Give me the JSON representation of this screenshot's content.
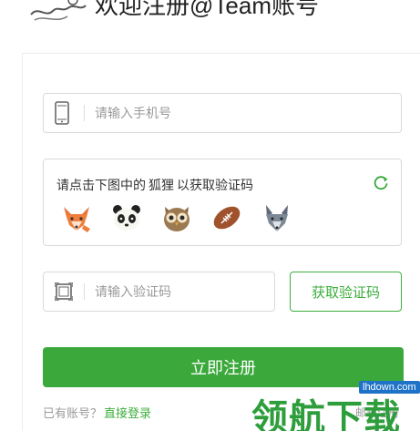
{
  "header": {
    "title": "欢迎注册@Team账号",
    "logo_icon": "bird-logo-icon"
  },
  "form": {
    "phone": {
      "placeholder": "请输入手机号",
      "value": "",
      "icon": "mobile-phone-icon"
    },
    "captcha": {
      "prompt_prefix": "请点击下图中的",
      "prompt_target": "狐狸",
      "prompt_suffix": "以获取验证码",
      "refresh_icon": "refresh-icon",
      "animals": [
        {
          "name": "fox-icon"
        },
        {
          "name": "panda-icon"
        },
        {
          "name": "owl-icon"
        },
        {
          "name": "football-icon"
        },
        {
          "name": "wolf-icon"
        }
      ]
    },
    "code": {
      "placeholder": "请输入验证码",
      "value": "",
      "icon": "scan-frame-icon"
    },
    "get_code_label": "获取验证码",
    "submit_label": "立即注册"
  },
  "footer": {
    "have_account": "已有账号？",
    "login_link": "直接登录",
    "right_text": "邮箱注册"
  },
  "watermark": {
    "url": "lhdown.com",
    "text": "领航下载"
  },
  "colors": {
    "accent": "#3aa83a",
    "border": "#d9d9d9",
    "placeholder": "#999999"
  }
}
